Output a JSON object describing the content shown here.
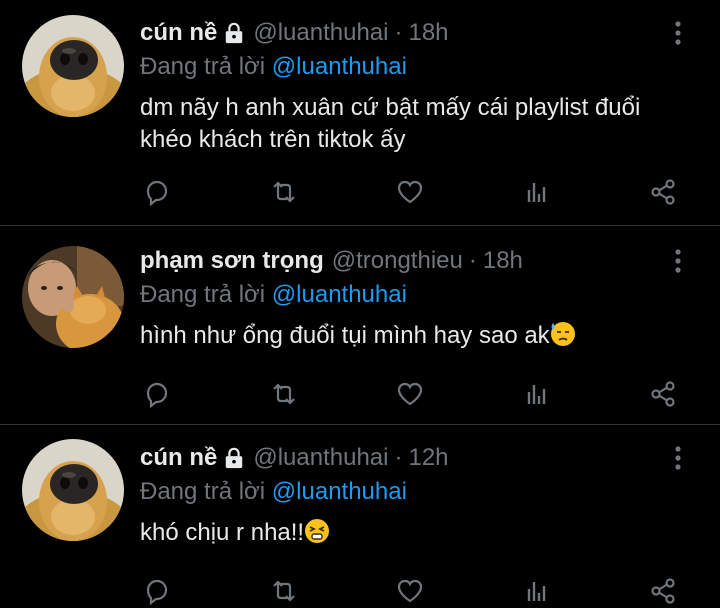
{
  "tweets": [
    {
      "name": "cún nề",
      "locked": true,
      "handle": "@luanthuhai",
      "separator": "·",
      "time": "18h",
      "reply_prefix": "Đang trả lời",
      "reply_to": "@luanthuhai",
      "text": "dm nãy h anh xuân cứ bật mấy cái playlist đuổi khéo khách trên tiktok ấy",
      "emoji": null
    },
    {
      "name": "phạm sơn trọng",
      "locked": false,
      "handle": "@trongthieu",
      "separator": "·",
      "time": "18h",
      "reply_prefix": "Đang trả lời",
      "reply_to": "@luanthuhai",
      "text": "hình như ổng đuổi tụi mình hay sao ak",
      "emoji": "downcast-face-sweat"
    },
    {
      "name": "cún nề",
      "locked": true,
      "handle": "@luanthuhai",
      "separator": "·",
      "time": "12h",
      "reply_prefix": "Đang trả lời",
      "reply_to": "@luanthuhai",
      "text": "khó chịu r nha!!",
      "emoji": "persevering-face"
    }
  ],
  "icons": [
    "reply-icon",
    "retweet-icon",
    "like-icon",
    "analytics-icon",
    "share-icon",
    "more-icon",
    "lock-icon"
  ],
  "colors": {
    "background": "#000000",
    "text": "#e7e9ea",
    "muted": "#71767b",
    "link": "#1d9bf0",
    "divider": "#2f3336"
  }
}
